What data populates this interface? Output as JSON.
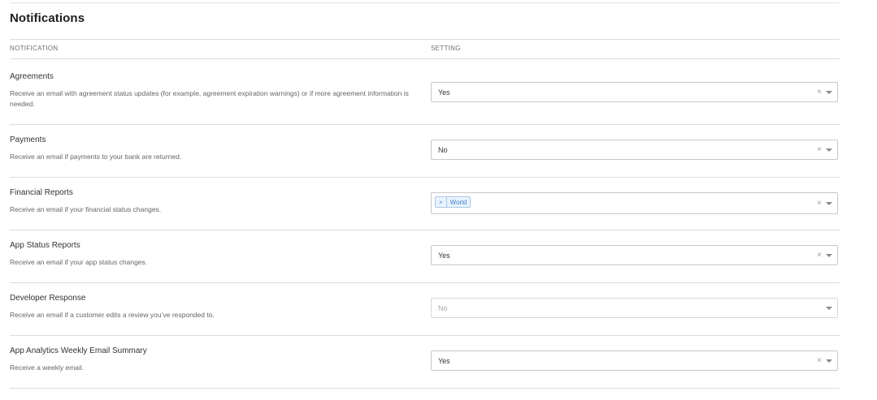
{
  "page": {
    "title": "Notifications"
  },
  "table": {
    "col_notification": "NOTIFICATION",
    "col_setting": "SETTING"
  },
  "rows": [
    {
      "title": "Agreements",
      "description": "Receive an email with agreement status updates (for example, agreement expiration warnings) or if more agreement information is needed.",
      "value": "Yes"
    },
    {
      "title": "Payments",
      "description": "Receive an email if payments to your bank are returned.",
      "value": "No"
    },
    {
      "title": "Financial Reports",
      "description": "Receive an email if your financial status changes.",
      "tag_remove": "×",
      "tag_label": "World"
    },
    {
      "title": "App Status Reports",
      "description": "Receive an email if your app status changes.",
      "value": "Yes"
    },
    {
      "title": "Developer Response",
      "description": "Receive an email if a customer edits a review you’ve responded to.",
      "value": "No",
      "disabled": true
    },
    {
      "title": "App Analytics Weekly Email Summary",
      "description": "Receive a weekly email.",
      "value": "Yes"
    }
  ],
  "icons": {
    "clear": "×",
    "caret": "chevron-down-icon"
  },
  "colors": {
    "tag_background": "#eaf3fd",
    "tag_text": "#3f7fc4",
    "divider": "#dcdcdc"
  }
}
